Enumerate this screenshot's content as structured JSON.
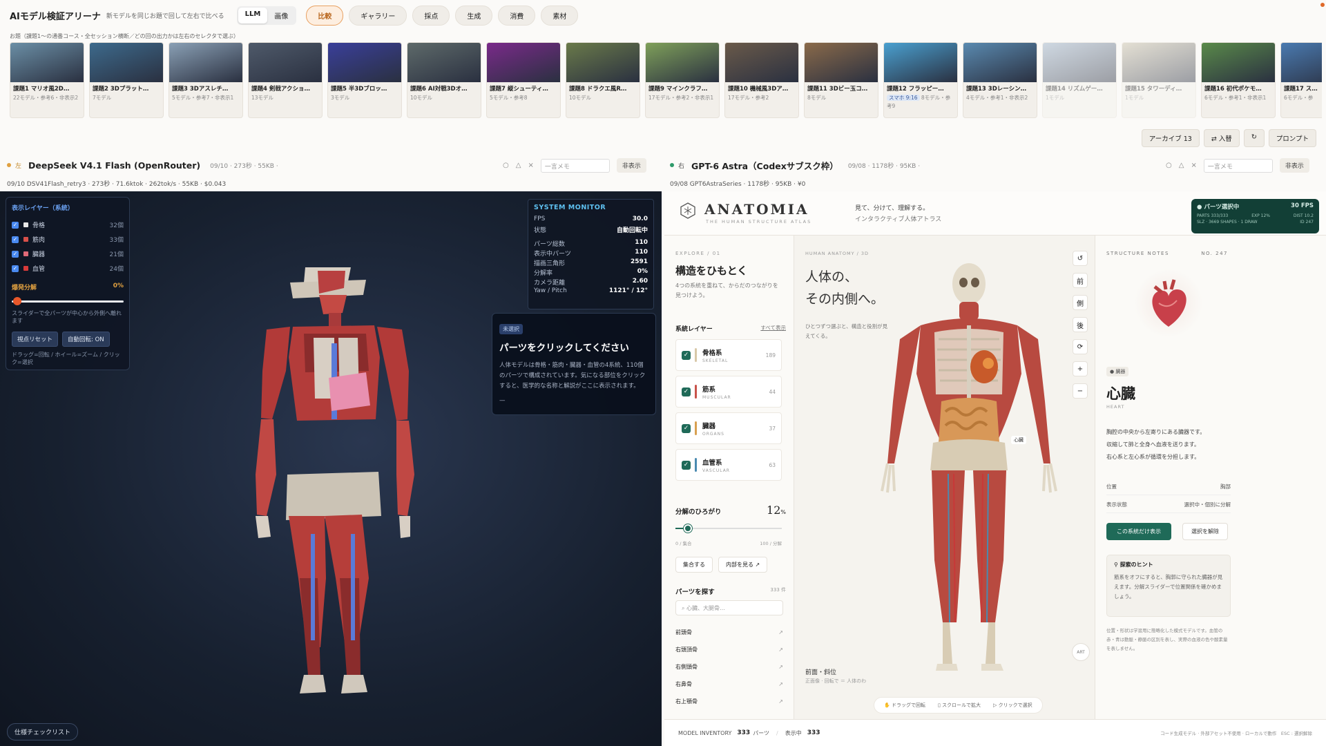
{
  "header": {
    "title": "AIモデル検証アリーナ",
    "subtitle": "新モデルを同じお題で回して左右で比べる",
    "modes": [
      "LLM",
      "画像"
    ],
    "nav": [
      "比較",
      "ギャラリー",
      "採点",
      "生成",
      "消費",
      "素材"
    ]
  },
  "hint": "お題（課題1〜の通番コース・全セッション横断／どの回の出力かは左右のセレクタで選ぶ）",
  "cards": [
    {
      "title": "課題1 マリオ風2D…",
      "meta": "22モデル・参考6・非表示2",
      "tag": ""
    },
    {
      "title": "課題2 3Dプラット…",
      "meta": "7モデル",
      "tag": ""
    },
    {
      "title": "課題3 3Dアスレチ…",
      "meta": "5モデル・参考7・非表示1",
      "tag": ""
    },
    {
      "title": "課題4 剣戟アクショ…",
      "meta": "13モデル",
      "tag": ""
    },
    {
      "title": "課題5 半3Dブロッ…",
      "meta": "3モデル",
      "tag": ""
    },
    {
      "title": "課題6 AI対戦3Dオ…",
      "meta": "10モデル",
      "tag": ""
    },
    {
      "title": "課題7 縦シューティ…",
      "meta": "5モデル・参考8",
      "tag": ""
    },
    {
      "title": "課題8 ドラクエ風R…",
      "meta": "10モデル",
      "tag": ""
    },
    {
      "title": "課題9 マインクラフ…",
      "meta": "17モデル・参考2・非表示1",
      "tag": ""
    },
    {
      "title": "課題10 機械風3Dア…",
      "meta": "17モデル・参考2",
      "tag": ""
    },
    {
      "title": "課題11 3Dビー玉コ…",
      "meta": "8モデル",
      "tag": ""
    },
    {
      "title": "課題12 フラッピー…",
      "meta": "8モデル・参考9",
      "tag": "スマホ 9:16"
    },
    {
      "title": "課題13 3Dレーシン…",
      "meta": "4モデル・参考1・非表示2",
      "tag": ""
    },
    {
      "title": "課題14 リズムゲー…",
      "meta": "1モデル",
      "tag": ""
    },
    {
      "title": "課題15 タワーディ…",
      "meta": "1モデル",
      "tag": ""
    },
    {
      "title": "課題16 初代ポケモ…",
      "meta": "6モデル・参考1・非表示1",
      "tag": ""
    },
    {
      "title": "課題17 ス…",
      "meta": "6モデル・参",
      "tag": ""
    }
  ],
  "card_colors": [
    "#6b8fa6",
    "#3d6a8c",
    "#8aa0b5",
    "#4f5a6a",
    "#3a3f9a",
    "#5e6a6a",
    "#7a2a8a",
    "#6a7a4a",
    "#7fa05a",
    "#6a5a4a",
    "#8a6a4a",
    "#4aa0d0",
    "#5a8ab0",
    "#9ab0c8",
    "#c8c0a8",
    "#5a8a4a",
    "#4a7ab0"
  ],
  "toolbar": [
    "アーカイブ 13",
    "⇄ 入替",
    "↻",
    "プロンプト"
  ],
  "left": {
    "side": "左",
    "model": "DeepSeek V4.1 Flash (OpenRouter)",
    "meta": "09/10 · 273秒 · 55KB ·",
    "memo": "一言メモ",
    "hide": "非表示",
    "subline": "09/10 DSV41Flash_retry3 · 273秒 · 71.6ktok · 262tok/s · 55KB · $0.043",
    "layers_title": "表示レイヤー（系統）",
    "layers": [
      {
        "name": "骨格",
        "count": "32個",
        "color": "#e8e8e8"
      },
      {
        "name": "筋肉",
        "count": "33個",
        "color": "#d8504a"
      },
      {
        "name": "臓器",
        "count": "21個",
        "color": "#e06a78"
      },
      {
        "name": "血管",
        "count": "24個",
        "color": "#d83a3a"
      }
    ],
    "explode_label": "爆発分解",
    "explode_value": "0%",
    "slider_note": "スライダーで全パーツが中心から外側へ離れます",
    "reset": "視点リセット",
    "autorot": "自動回転: ON",
    "controls_note": "ドラッグ=回転 / ホイール=ズーム / クリック=選択",
    "monitor_title": "SYSTEM MONITOR",
    "monitor": [
      {
        "k": "FPS",
        "v": "30.0"
      },
      {
        "k": "状態",
        "v": "自動回転中"
      },
      {
        "k": "パーツ総数",
        "v": "110"
      },
      {
        "k": "表示中パーツ",
        "v": "110"
      },
      {
        "k": "描画三角形",
        "v": "2591"
      },
      {
        "k": "分解率",
        "v": "0%"
      },
      {
        "k": "カメラ距離",
        "v": "2.60"
      },
      {
        "k": "Yaw / Pitch",
        "v": "1121° / 12°"
      }
    ],
    "info_badge": "未選択",
    "info_title": "パーツをクリックしてください",
    "info_text": "人体モデルは骨格・筋肉・臓器・血管の4系統、110個のパーツで構成されています。気になる部位をクリックすると、医学的な名称と解説がここに表示されます。",
    "info_dash": "—",
    "spec": "仕様チェックリスト"
  },
  "right": {
    "side": "右",
    "model": "GPT-6 Astra（Codexサブスク枠）",
    "meta": "09/08 · 1178秒 · 95KB ·",
    "memo": "一言メモ",
    "hide": "非表示",
    "subline": "09/08 GPT6AstraSeries · 1178秒 · 95KB · ¥0",
    "brand": "ANATOMIA",
    "brand_sub": "THE HUMAN STRUCTURE ATLAS",
    "tag1": "見て、分けて、理解する。",
    "tag2": "インタラクティブ人体アトラス",
    "fps_label": "● パーツ選択中",
    "fps_value": "30 FPS",
    "fps_l1": "PARTS 333/333",
    "fps_l1b": "EXP 12%",
    "fps_l1c": "DIST 10.2",
    "fps_l2": "SLZ · 3669 SHAPES · 1 DRAW",
    "fps_l2c": "ID 247",
    "explore": "EXPLORE / 01",
    "explore_title": "構造をひもとく",
    "explore_desc": "4つの系統を重ねて、からだのつながりを見つけよう。",
    "layers_title": "系統レイヤー",
    "layers_all": "すべて表示",
    "layers": [
      {
        "jp": "骨格系",
        "en": "SKELETAL",
        "count": "189",
        "color": "#d8c8a8"
      },
      {
        "jp": "筋系",
        "en": "MUSCULAR",
        "count": "44",
        "color": "#c8524a"
      },
      {
        "jp": "臓器",
        "en": "ORGANS",
        "count": "37",
        "color": "#d8a050"
      },
      {
        "jp": "血管系",
        "en": "VASCULAR",
        "count": "63",
        "color": "#4a8ab0"
      }
    ],
    "spread_label": "分解のひろがり",
    "spread_value": "12",
    "spread_unit": "%",
    "spread_fraction": 0.12,
    "spread_min": "0 / 集合",
    "spread_max": "100 / 分解",
    "btn_gather": "集合する",
    "btn_inside": "内部を見る ↗",
    "search_title": "パーツを探す",
    "search_count": "333 件",
    "search_placeholder": "心臓、大腿骨…",
    "parts": [
      "前頭骨",
      "右頭頂骨",
      "右側頭骨",
      "右鼻骨",
      "右上顎骨"
    ],
    "crumb": "HUMAN ANATOMY / 3D",
    "hero1": "人体の、",
    "hero2": "その内側へ。",
    "hero_desc": "ひとつずつ選ぶと、構造と役割が見えてくる。",
    "view_label": "前面・斜位",
    "view_sub": "正面像 · 回転で ＝ 人体のわ",
    "hint_drag": "ドラッグで回転",
    "hint_scroll": "スクロールで拡大",
    "hint_click": "クリックで選択",
    "tools": [
      "↺",
      "前",
      "側",
      "後",
      "⟳",
      "+",
      "−"
    ],
    "art": "ART",
    "heart_label": "心臓",
    "notes_title": "STRUCTURE NOTES",
    "notes_no": "NO. 247",
    "organ_tag": "● 臓器",
    "organ_name": "心臓",
    "organ_en": "HEART",
    "organ_desc1": "胸腔の中央から左寄りにある臓器です。",
    "organ_desc2": "収縮して肺と全身へ血液を送ります。",
    "organ_desc3": "右心系と左心系が循環を分担します。",
    "pos_k": "位置",
    "pos_v": "胸部",
    "state_k": "表示状態",
    "state_v": "選択中・個別に分解",
    "btn_only": "この系統だけ表示",
    "btn_clear": "選択を解除",
    "tip_title": "探索のヒント",
    "tip_text": "筋系をオフにすると、胸郭に守られた臓器が見えます。分解スライダーで位置関係を確かめましょう。",
    "fine": "位置・形状は学習用に簡略化した模式モデルです。血管の赤・青は動脈・静脈の区別を表し、実際の血液の色や酸素量を表しません。",
    "foot_inv": "MODEL INVENTORY",
    "foot_parts": "333",
    "foot_parts_u": "パーツ",
    "foot_show": "表示中",
    "foot_show_v": "333",
    "foot_right": "コード生成モデル · 外部アセット不使用 · ローカルで動作　ESC : 選択解除"
  }
}
